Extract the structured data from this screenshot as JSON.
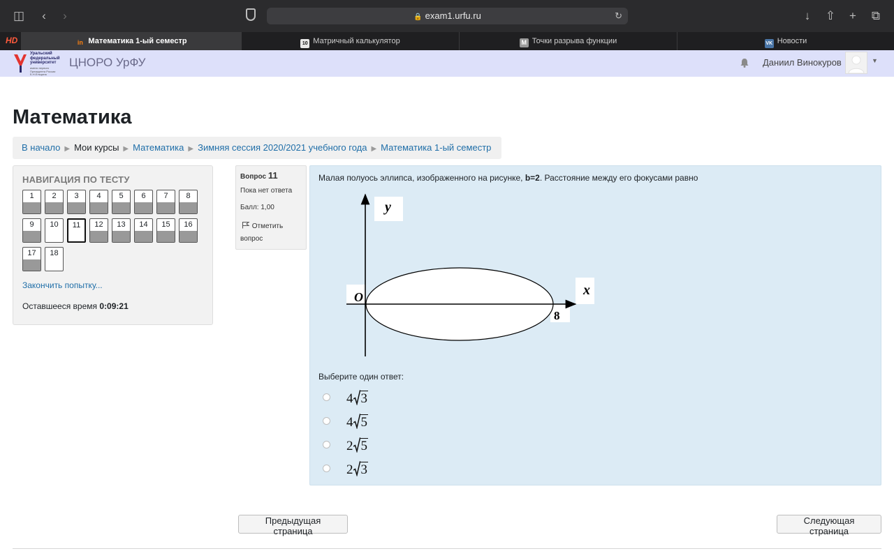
{
  "browser": {
    "url": "exam1.urfu.ru",
    "tabs": [
      {
        "label": "Математика 1-ый семестр",
        "favicon": "in"
      },
      {
        "label": "Матричный калькулятор",
        "favicon": "10"
      },
      {
        "label": "Точки разрыва функции",
        "favicon": "M"
      },
      {
        "label": "Новости",
        "favicon": "VK"
      }
    ]
  },
  "header": {
    "logo_text": "Уральский федеральный университет",
    "logo_sub": "имени первого Президента России Б.Н.Ельцина",
    "site_name": "ЦНОРО УрФУ",
    "user_name": "Даниил Винокуров"
  },
  "page": {
    "title": "Математика",
    "breadcrumb": [
      "В начало",
      "Мои курсы",
      "Математика",
      "Зимняя сессия 2020/2021 учебного года",
      "Математика 1-ый семестр"
    ]
  },
  "quiz_nav": {
    "heading": "НАВИГАЦИЯ ПО ТЕСТУ",
    "questions": [
      {
        "num": "1",
        "answered": true
      },
      {
        "num": "2",
        "answered": true
      },
      {
        "num": "3",
        "answered": true
      },
      {
        "num": "4",
        "answered": true
      },
      {
        "num": "5",
        "answered": true
      },
      {
        "num": "6",
        "answered": true
      },
      {
        "num": "7",
        "answered": true
      },
      {
        "num": "8",
        "answered": true
      },
      {
        "num": "9",
        "answered": true
      },
      {
        "num": "10",
        "answered": false
      },
      {
        "num": "11",
        "answered": false,
        "current": true
      },
      {
        "num": "12",
        "answered": true
      },
      {
        "num": "13",
        "answered": true
      },
      {
        "num": "14",
        "answered": true
      },
      {
        "num": "15",
        "answered": true
      },
      {
        "num": "16",
        "answered": true
      },
      {
        "num": "17",
        "answered": true
      },
      {
        "num": "18",
        "answered": false
      }
    ],
    "finish_link": "Закончить попытку...",
    "time_label": "Оставшееся время",
    "time_value": "0:09:21"
  },
  "question": {
    "number_label": "Вопрос",
    "number": "11",
    "state": "Пока нет ответа",
    "grade": "Балл: 1,00",
    "flag_label": "Отметить вопрос",
    "text_before": "Малая полуось эллипса, изображенного на рисунке, ",
    "text_bold": "b=2",
    "text_after": ". Расстояние между его фокусами равно",
    "figure_labels": {
      "y": "y",
      "x": "x",
      "o": "O",
      "eight": "8"
    },
    "prompt": "Выберите один ответ:",
    "answers": [
      {
        "coef": "4",
        "radicand": "3"
      },
      {
        "coef": "4",
        "radicand": "5"
      },
      {
        "coef": "2",
        "radicand": "5"
      },
      {
        "coef": "2",
        "radicand": "3"
      }
    ]
  },
  "buttons": {
    "prev": "Предыдущая страница",
    "next": "Следующая страница"
  }
}
